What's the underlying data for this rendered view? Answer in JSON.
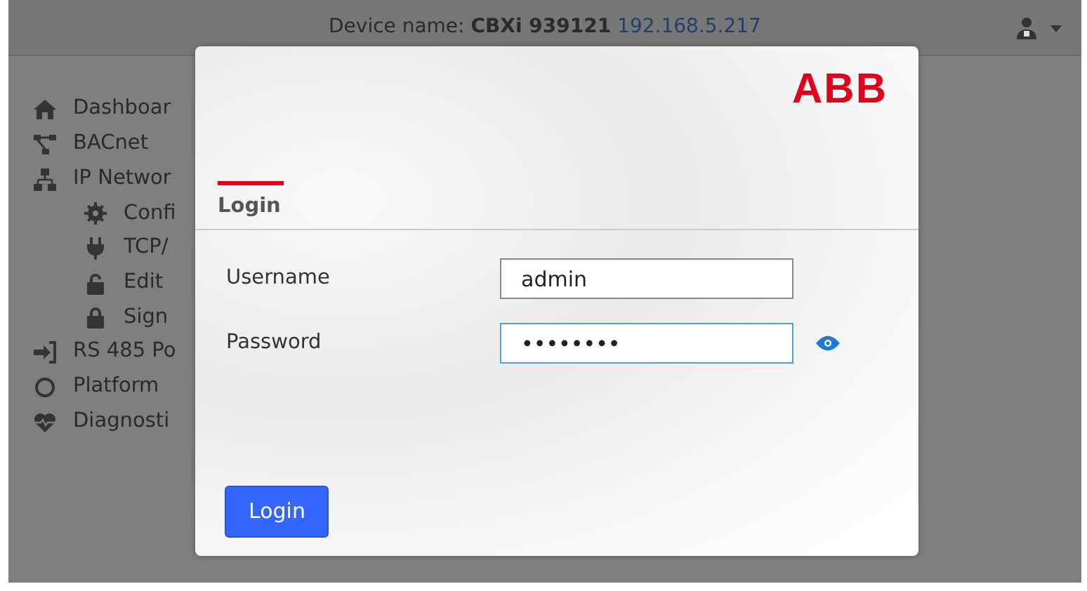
{
  "header": {
    "device_label": "Device name:",
    "device_name": "CBXi 939121",
    "ip_address": "192.168.5.217"
  },
  "sidebar": {
    "items": [
      {
        "label": "Dashboar"
      },
      {
        "label": "BACnet"
      },
      {
        "label": "IP Networ",
        "children": [
          {
            "label": "Confi"
          },
          {
            "label": "TCP/"
          },
          {
            "label": "Edit"
          },
          {
            "label": "Sign"
          }
        ]
      },
      {
        "label": "RS 485 Po"
      },
      {
        "label": "Platform"
      },
      {
        "label": "Diagnosti"
      }
    ]
  },
  "login_dialog": {
    "logo": "ABB",
    "title": "Login",
    "fields": [
      {
        "label": "Username",
        "value": "admin",
        "focused": false,
        "reveal_icon": false
      },
      {
        "label": "Password",
        "value": "••••••••",
        "focused": true,
        "reveal_icon": true
      }
    ],
    "submit": "Login"
  }
}
